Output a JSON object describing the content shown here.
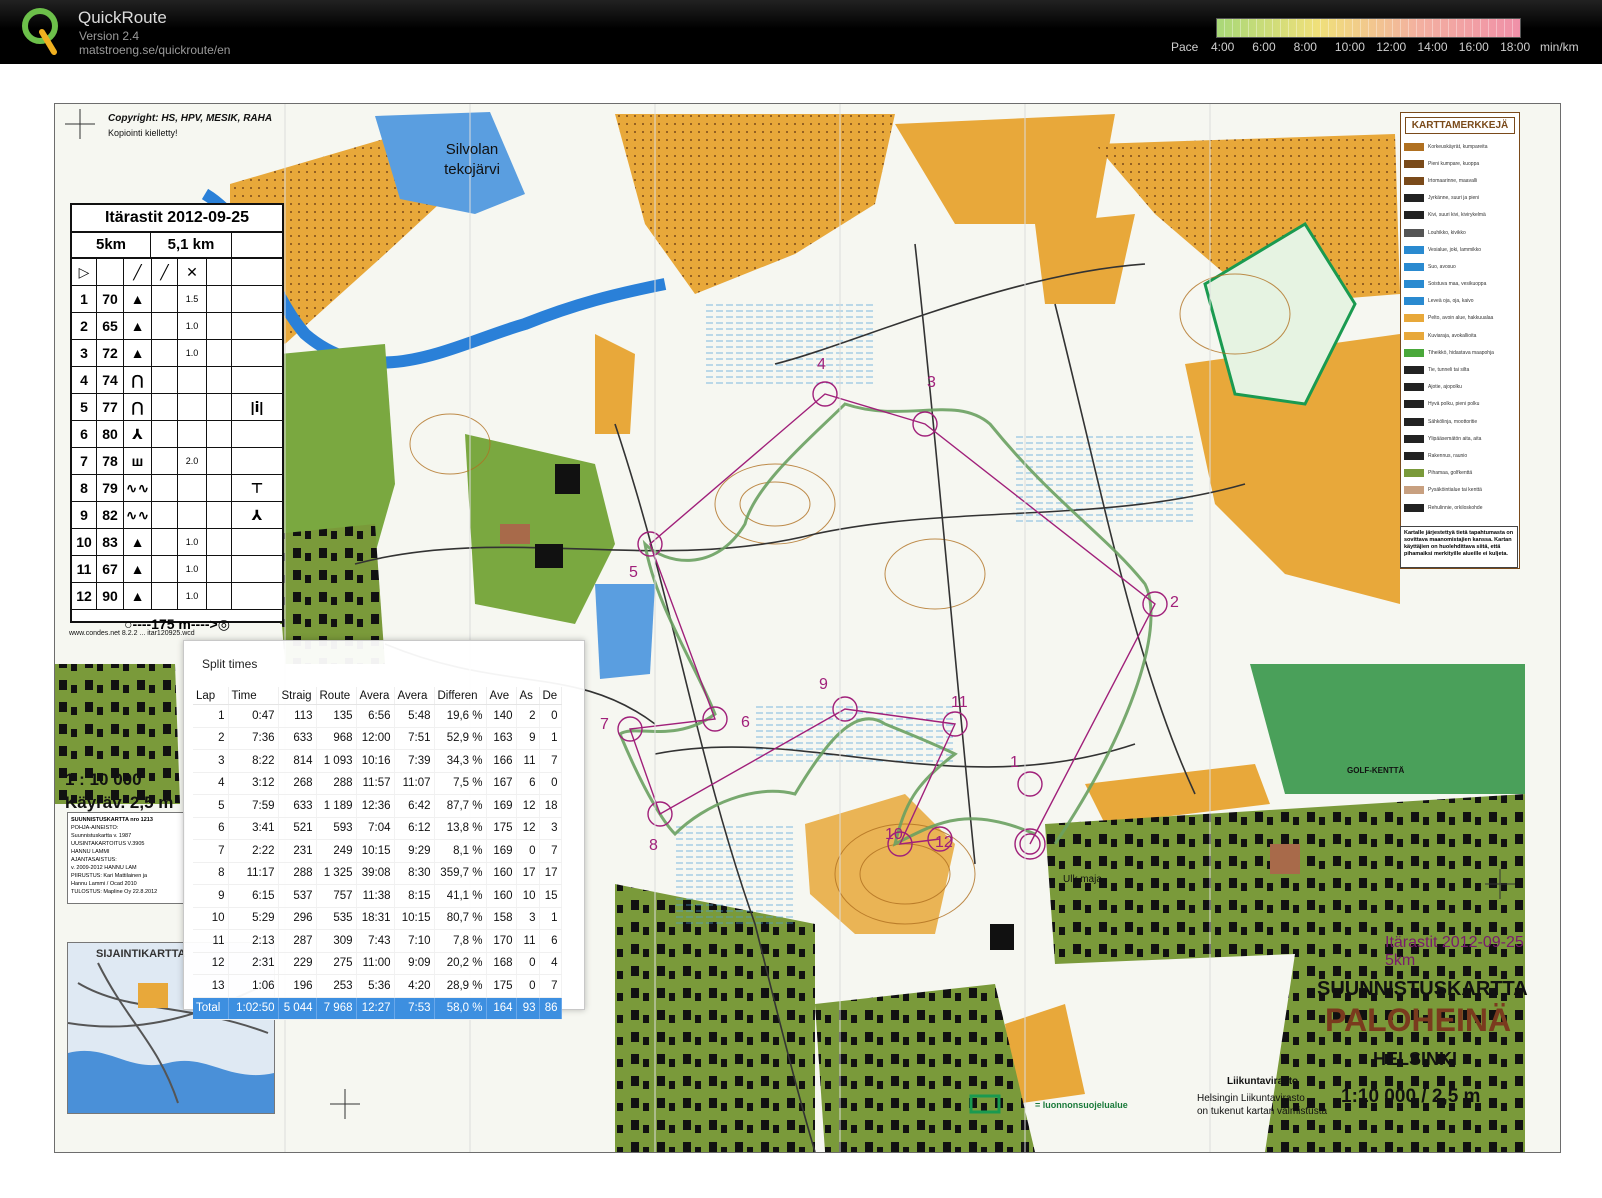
{
  "app": {
    "name": "QuickRoute",
    "version": "Version 2.4",
    "url": "matstroeng.se/quickroute/en"
  },
  "pace_scale": {
    "label": "Pace",
    "ticks": [
      "4:00",
      "6:00",
      "8:00",
      "10:00",
      "12:00",
      "14:00",
      "16:00",
      "18:00"
    ],
    "unit": "min/km",
    "colors": [
      "#a8d878",
      "#f0e07a",
      "#f3b0a0",
      "#f090a8"
    ]
  },
  "map": {
    "copyright": "Copyright:  HS, HPV, MESIK, RAHA",
    "copy_note": "Kopiointi kielletty!",
    "lake": "Silvolan tekojärvi",
    "condes": "www.condes.net 8.2.2 ... itar120925.wcd",
    "scale_ratio": "1 : 10 000",
    "contour": "Käyräv. 2,5 m",
    "golf": "GOLF-KENTTÄ",
    "event": "Itärastit 2012-09-25",
    "event_course": "5km",
    "title_line1": "SUUNNISTUSKARTTA",
    "title_line2": "PALOHEINÄ",
    "title_line3": "HELSINKI",
    "agency": "Liikuntavirasto",
    "agency_note_1": "Helsingin Liikuntavirasto",
    "agency_note_2": "on tukenut kartan valmistusta",
    "scale_full": "1:10 000 / 2,5 m",
    "protected": "= luonnonsuojelualue",
    "house": "Ulk.maja",
    "location_map": "SIJAINTIKARTTA",
    "info_title": "SUUNNISTUSKARTTA  nro 1213",
    "info_lines": [
      "POHJA-AINEISTO:",
      "Suunnistuskartta v. 1987",
      "UUSINTAKARTOITUS  V.3905",
      "HANNU LAMMI",
      "AJANTASAISTUS:",
      "v. 2009-2012  HANNU LAM",
      "PIIRUSTUS:  Kari Mattilainen ja",
      "Hannu Lammi / Ocad 2010",
      "TULOSTUS:  Mapline Oy 22.8.2012"
    ],
    "control_numbers": [
      "1",
      "2",
      "3",
      "4",
      "5",
      "6",
      "7",
      "8",
      "9",
      "10",
      "11",
      "12"
    ],
    "legend_title": "KARTTAMERKKEJÄ",
    "legend_items": [
      "Korkeuskäyrät, kumpareita",
      "Pieni kumpare, kuoppa",
      "Irtomaarinne, maavalli",
      "Jyrkänne, suuri ja pieni",
      "Kivi, suuri kivi, kivirykelmä",
      "Louhikko, kivikko",
      "Vesialue, joki, lammikko",
      "Suo, avosuo",
      "Soistuva maa, vesikuoppa",
      "Leveä oja, oja, kaivo",
      "Pelto, avoin alue, hakkuualaa",
      "Kuviaraja, avokallioita",
      "Tiheikkö, hidastava maapohja",
      "Tie, tunneli tai silta",
      "Ajotie, ajopolku",
      "Hyvä polku, pieni polku",
      "Sähkölinja, moottoritie",
      "Ylipääsemätön aita, aita",
      "Rakennus, raunio",
      "Pihamaa, golfkenttä",
      "Pysäköintialue tai kenttä",
      "Rehulinnie, orkiloskohde"
    ],
    "legend_colors": [
      "#b07020",
      "#7a4a1a",
      "#7a4a1a",
      "#222222",
      "#222222",
      "#555555",
      "#2a8ad0",
      "#2a8ad0",
      "#2a8ad0",
      "#2a8ad0",
      "#e8a83a",
      "#e8a83a",
      "#4aa83a",
      "#222222",
      "#222222",
      "#222222",
      "#222222",
      "#222222",
      "#222222",
      "#7a9a3a",
      "#c8a080",
      "#222222"
    ],
    "legend_note": "Kartalle järjestettyä tietä tapahtumasta on sovittava maanomistajien kanssa. Kartan käyttäjien on huolehdittava siitä, että pihamaiksi merkityille alueille ei kuljeta."
  },
  "course_card": {
    "title": "Itärastit 2012-09-25",
    "class": "5km",
    "length": "5,1 km",
    "start_symbol": "▷",
    "controls": [
      {
        "n": "1",
        "code": "70",
        "sym": "▲",
        "note": "1.5",
        "extra": ""
      },
      {
        "n": "2",
        "code": "65",
        "sym": "▲",
        "note": "1.0",
        "extra": ""
      },
      {
        "n": "3",
        "code": "72",
        "sym": "▲",
        "note": "1.0",
        "extra": ""
      },
      {
        "n": "4",
        "code": "74",
        "sym": "⋂",
        "note": "",
        "extra": ""
      },
      {
        "n": "5",
        "code": "77",
        "sym": "⋂",
        "note": "",
        "extra": "|ⅰ|"
      },
      {
        "n": "6",
        "code": "80",
        "sym": "⅄",
        "note": "",
        "extra": ""
      },
      {
        "n": "7",
        "code": "78",
        "sym": "ш",
        "note": "2.0",
        "extra": ""
      },
      {
        "n": "8",
        "code": "79",
        "sym": "∿∿",
        "note": "",
        "extra": "⊤"
      },
      {
        "n": "9",
        "code": "82",
        "sym": "∿∿",
        "note": "",
        "extra": "⅄"
      },
      {
        "n": "10",
        "code": "83",
        "sym": "▲",
        "note": "1.0",
        "extra": ""
      },
      {
        "n": "11",
        "code": "67",
        "sym": "▲",
        "note": "1.0",
        "extra": ""
      },
      {
        "n": "12",
        "code": "90",
        "sym": "▲",
        "note": "1.0",
        "extra": ""
      }
    ],
    "finish": "○----175 m---->◎"
  },
  "splits": {
    "title": "Split times",
    "columns": [
      "Lap",
      "Time",
      "Straig",
      "Route",
      "Avera",
      "Avera",
      "Differen",
      "Ave",
      "As",
      "De"
    ],
    "rows": [
      [
        "1",
        "0:47",
        "113",
        "135",
        "6:56",
        "5:48",
        "19,6 %",
        "140",
        "2",
        "0"
      ],
      [
        "2",
        "7:36",
        "633",
        "968",
        "12:00",
        "7:51",
        "52,9 %",
        "163",
        "9",
        "1"
      ],
      [
        "3",
        "8:22",
        "814",
        "1 093",
        "10:16",
        "7:39",
        "34,3 %",
        "166",
        "11",
        "7"
      ],
      [
        "4",
        "3:12",
        "268",
        "288",
        "11:57",
        "11:07",
        "7,5 %",
        "167",
        "6",
        "0"
      ],
      [
        "5",
        "7:59",
        "633",
        "1 189",
        "12:36",
        "6:42",
        "87,7 %",
        "169",
        "12",
        "18"
      ],
      [
        "6",
        "3:41",
        "521",
        "593",
        "7:04",
        "6:12",
        "13,8 %",
        "175",
        "12",
        "3"
      ],
      [
        "7",
        "2:22",
        "231",
        "249",
        "10:15",
        "9:29",
        "8,1 %",
        "169",
        "0",
        "7"
      ],
      [
        "8",
        "11:17",
        "288",
        "1 325",
        "39:08",
        "8:30",
        "359,7 %",
        "160",
        "17",
        "17"
      ],
      [
        "9",
        "6:15",
        "537",
        "757",
        "11:38",
        "8:15",
        "41,1 %",
        "160",
        "10",
        "15"
      ],
      [
        "10",
        "5:29",
        "296",
        "535",
        "18:31",
        "10:15",
        "80,7 %",
        "158",
        "3",
        "1"
      ],
      [
        "11",
        "2:13",
        "287",
        "309",
        "7:43",
        "7:10",
        "7,8 %",
        "170",
        "11",
        "6"
      ],
      [
        "12",
        "2:31",
        "229",
        "275",
        "11:00",
        "9:09",
        "20,2 %",
        "168",
        "0",
        "4"
      ],
      [
        "13",
        "1:06",
        "196",
        "253",
        "5:36",
        "4:20",
        "28,9 %",
        "175",
        "0",
        "7"
      ]
    ],
    "total": [
      "Total",
      "1:02:50",
      "5 044",
      "7 968",
      "12:27",
      "7:53",
      "58,0 %",
      "164",
      "93",
      "86"
    ]
  }
}
